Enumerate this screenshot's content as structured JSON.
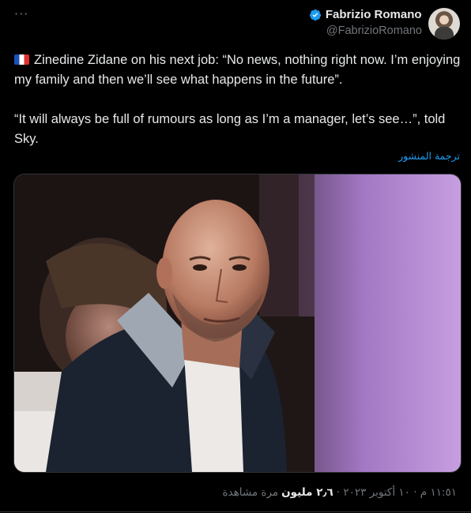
{
  "header": {
    "more_label": "···",
    "author_name": "Fabrizio Romano",
    "author_handle": "@FabrizioRomano"
  },
  "tweet": {
    "paragraph1": "Zinedine Zidane on his next job: “No news, nothing right now. I’m enjoying my family and then we’ll see what happens in the future”.",
    "paragraph2": "“It will always be full of rumours as long as I’m a manager, let’s see…”, told Sky.",
    "translate_label": "ترجمة المنشور"
  },
  "footer": {
    "time_date": "١١:٥١ م · ١٠ أكتوبر ٢٠٢٣ ·",
    "views_count": "٢٫٦ مليون",
    "views_label": "مرة مشاهدة"
  },
  "colors": {
    "background": "#000000",
    "text": "#e7e9ea",
    "muted": "#71767b",
    "link": "#1d9bf0",
    "verified": "#1d9bf0"
  },
  "icons": {
    "verified": "verified-badge-icon",
    "flag": "france-flag-icon",
    "more": "more-dots-icon"
  }
}
